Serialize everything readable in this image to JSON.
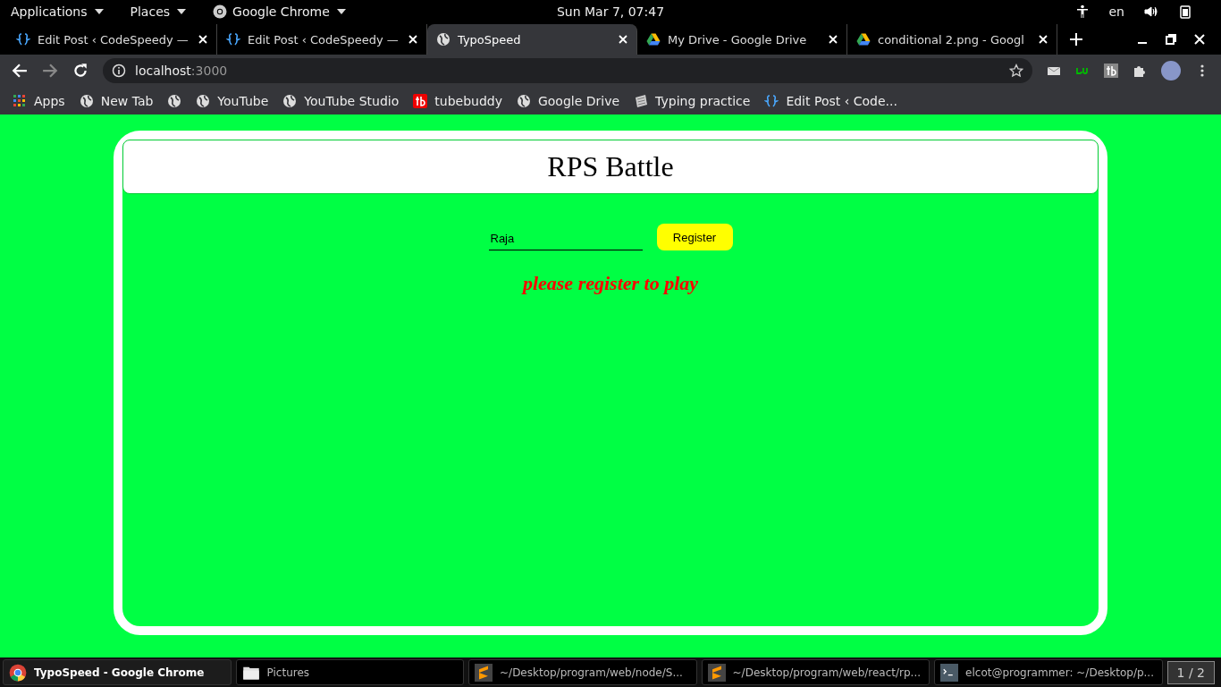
{
  "top_bar": {
    "menus": [
      {
        "label": "Applications"
      },
      {
        "label": "Places"
      },
      {
        "label": "Google Chrome"
      }
    ],
    "clock": "Sun Mar  7, 07:47",
    "language": "en"
  },
  "tabs": [
    {
      "title": "Edit Post ‹ CodeSpeedy —",
      "kind": "code",
      "selected": false
    },
    {
      "title": "Edit Post ‹ CodeSpeedy —",
      "kind": "code",
      "selected": false
    },
    {
      "title": "TypoSpeed",
      "kind": "globe",
      "selected": true
    },
    {
      "title": "My Drive - Google Drive",
      "kind": "drive",
      "selected": false
    },
    {
      "title": "conditional 2.png - Googl",
      "kind": "drive",
      "selected": false
    }
  ],
  "address_bar": {
    "host": "localhost",
    "port": ":3000"
  },
  "bookmarks": [
    {
      "label": "Apps",
      "kind": "grid"
    },
    {
      "label": "New Tab",
      "kind": "globe"
    },
    {
      "kind": "globe"
    },
    {
      "label": "YouTube",
      "kind": "globe"
    },
    {
      "label": "YouTube Studio",
      "kind": "globe"
    },
    {
      "label": "tubebuddy",
      "kind": "tb"
    },
    {
      "label": "Google Drive",
      "kind": "globe"
    },
    {
      "label": "Typing practice",
      "kind": "typing"
    },
    {
      "label": "Edit Post ‹ Code...",
      "kind": "code"
    }
  ],
  "page": {
    "title": "RPS Battle",
    "name_field": {
      "value": "Raja"
    },
    "register_button": "Register",
    "message": "please register to play"
  },
  "taskbar": {
    "items": [
      {
        "label": "TypoSpeed - Google Chrome",
        "kind": "chrome",
        "selected": true
      },
      {
        "label": "Pictures",
        "kind": "folder",
        "selected": false
      },
      {
        "label": "~/Desktop/program/web/node/S...",
        "kind": "sublime",
        "selected": false
      },
      {
        "label": "~/Desktop/program/web/react/rp...",
        "kind": "sublime",
        "selected": false
      },
      {
        "label": "elcot@programmer: ~/Desktop/p...",
        "kind": "terminal",
        "selected": false
      }
    ],
    "workspace": "1 / 2"
  }
}
